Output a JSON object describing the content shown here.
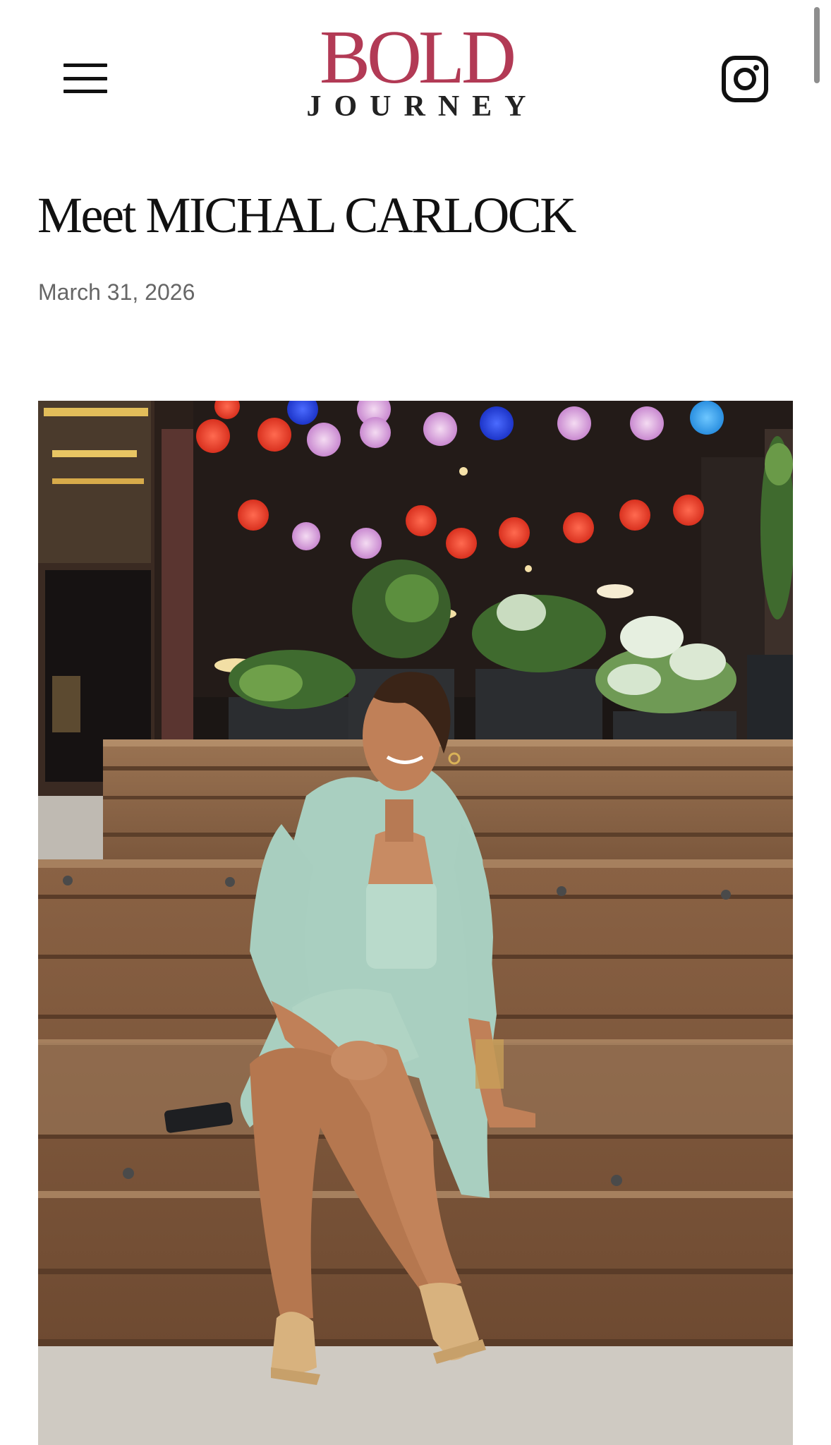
{
  "header": {
    "menu_icon": "hamburger-menu-icon",
    "logo": {
      "line1": "BOLD",
      "line2": "JOURNEY",
      "accent_color": "#b23a55"
    },
    "social_icon": "instagram-icon"
  },
  "article": {
    "title": "Meet MICHAL CARLOCK",
    "date": "March 31, 2026"
  }
}
